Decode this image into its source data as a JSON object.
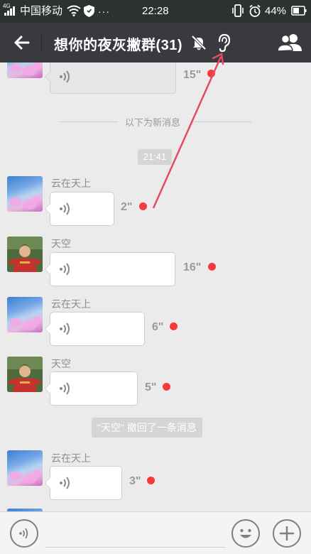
{
  "status_bar": {
    "network_type": "4G",
    "carrier": "中国移动",
    "more_indicator": "···",
    "time": "22:28",
    "battery_percent": "44%",
    "icons": [
      "signal-icon",
      "wifi-icon",
      "shield-icon",
      "vibrate-icon",
      "alarm-icon",
      "battery-icon"
    ]
  },
  "header": {
    "title": "想你的夜灰撇群(31)",
    "back_icon": "back-arrow-icon",
    "mute_icon": "mute-bell-icon",
    "earpiece_icon": "ear-icon",
    "members_icon": "group-members-icon"
  },
  "chat": {
    "first_partial_duration": "15\"",
    "new_messages_label": "以下为新消息",
    "time_label": "21:41",
    "messages": [
      {
        "sender": "云在天上",
        "duration": "2\"",
        "unplayed": true
      },
      {
        "sender": "天空",
        "duration": "16\"",
        "unplayed": true
      },
      {
        "sender": "云在天上",
        "duration": "6\"",
        "unplayed": true
      },
      {
        "sender": "天空",
        "duration": "5\"",
        "unplayed": true
      },
      {
        "sender": "云在天上",
        "duration": "3\"",
        "unplayed": true
      }
    ],
    "system_notice": "\"天空\" 撤回了一条消息"
  },
  "input_bar": {
    "voice_icon": "voice-input-icon",
    "emoji_icon": "emoji-icon",
    "add_icon": "plus-icon"
  },
  "colors": {
    "unread_dot": "#f43b3b",
    "annotation_arrow": "#e64a63",
    "title_bar": "#393a3f",
    "status_bar": "#2e3132"
  }
}
